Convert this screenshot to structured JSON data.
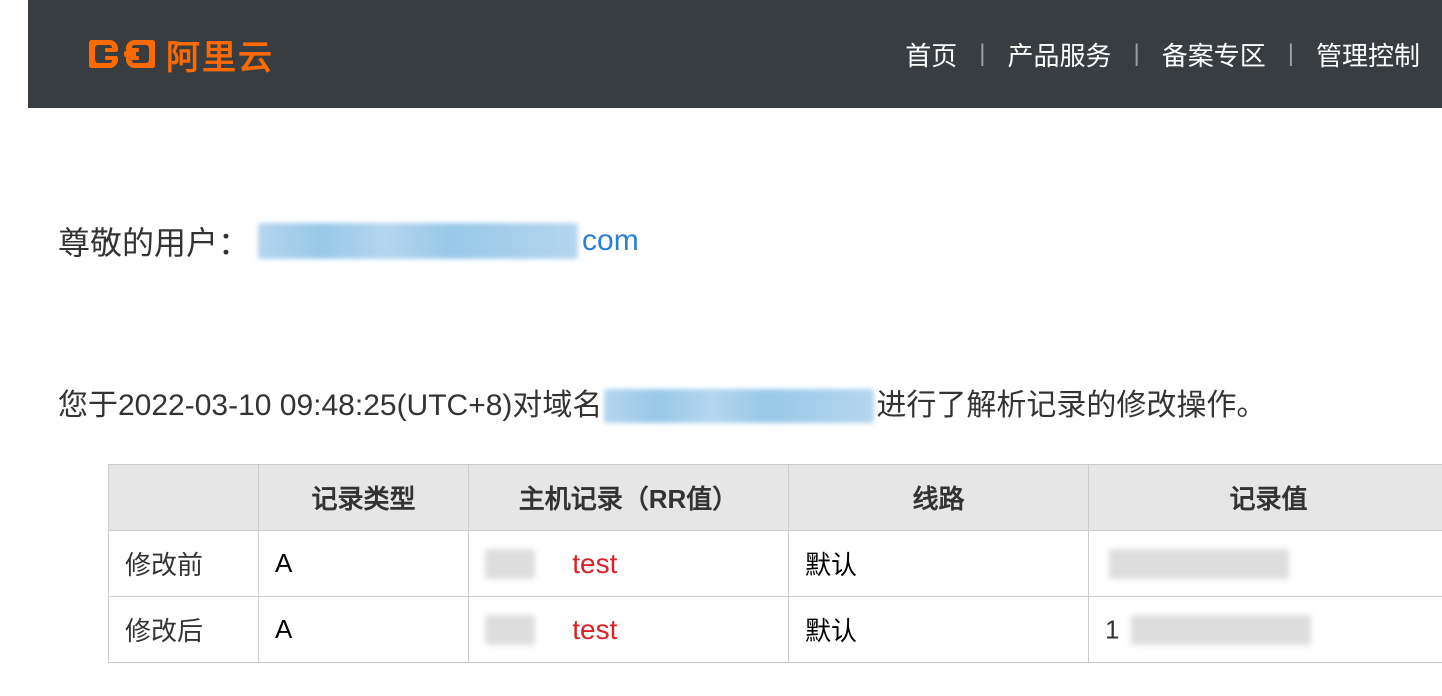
{
  "header": {
    "brand": "阿里云",
    "nav": {
      "home": "首页",
      "products": "产品服务",
      "beian": "备案专区",
      "console": "管理控制"
    }
  },
  "greeting": {
    "prefix": "尊敬的用户：",
    "email_suffix": "com"
  },
  "message": {
    "p1": "您于2022-03-10 09:48:25(UTC+8)对域名",
    "p2": "进行了解析记录的修改操作。"
  },
  "table": {
    "headers": {
      "h0": "",
      "h1": "记录类型",
      "h2": "主机记录（RR值）",
      "h3": "线路",
      "h4": "记录值"
    },
    "rows": [
      {
        "label": "修改前",
        "type": "A",
        "rr_annot": "test",
        "line": "默认",
        "val_prefix": ""
      },
      {
        "label": "修改后",
        "type": "A",
        "rr_annot": "test",
        "line": "默认",
        "val_prefix": "1"
      }
    ]
  }
}
